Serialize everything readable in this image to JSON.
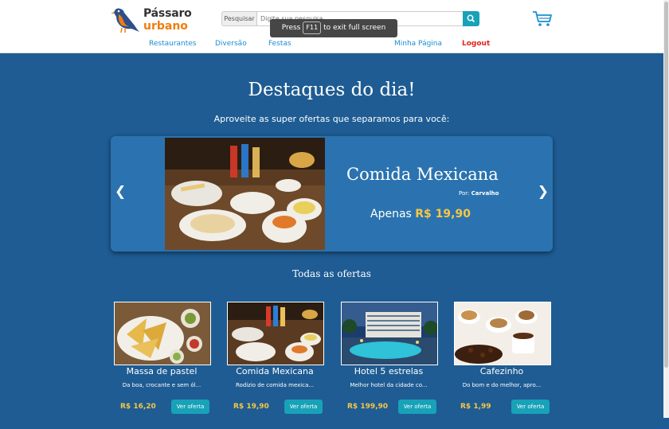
{
  "brand": {
    "line1": "Pássaro",
    "line2": "urbano"
  },
  "search": {
    "addon_label": "Pesquisar",
    "placeholder": "Digite sua pesquisa"
  },
  "toast": {
    "before": "Press",
    "key": "F11",
    "after": "to exit full screen"
  },
  "nav": {
    "restaurantes": "Restaurantes",
    "diversao": "Diversão",
    "festas": "Festas",
    "minha_pagina": "Minha Página",
    "logout": "Logout"
  },
  "hero": {
    "title": "Destaques do dia!",
    "subtitle": "Aproveite as super ofertas que separamos para você:"
  },
  "carousel": {
    "title": "Comida Mexicana",
    "by_label": "Por:",
    "by_name": "Carvalho",
    "price_prefix": "Apenas",
    "price": "R$ 19,90"
  },
  "offers": {
    "section_title": "Todas as ofertas",
    "button_label": "Ver oferta",
    "items": [
      {
        "name": "Massa de pastel",
        "desc": "Da boa, crocante e sem ól...",
        "price": "R$ 16,20"
      },
      {
        "name": "Comida Mexicana",
        "desc": "Rodizio de comida mexica...",
        "price": "R$ 19,90"
      },
      {
        "name": "Hotel 5 estrelas",
        "desc": "Melhor hotel da cidade co...",
        "price": "R$ 199,90"
      },
      {
        "name": "Cafezinho",
        "desc": "Do bom e do melhor, apro...",
        "price": "R$ 1,99"
      }
    ]
  },
  "colors": {
    "accent": "#17a2b8",
    "price": "#f7c744",
    "brand_orange": "#f07c10",
    "nav_link": "#1a8fd0",
    "logout": "#e2231a"
  }
}
